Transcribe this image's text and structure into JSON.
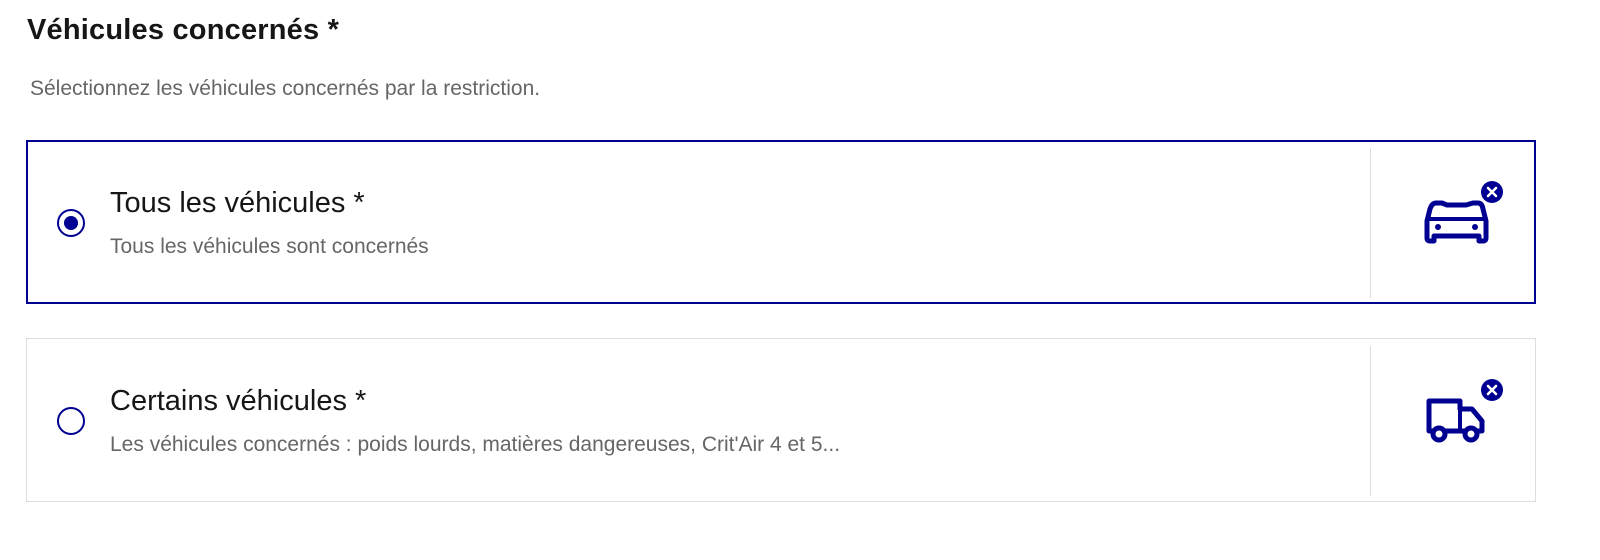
{
  "fieldset": {
    "legend": "Véhicules concernés *",
    "hint": "Sélectionnez les véhicules concernés par la restriction."
  },
  "options": [
    {
      "label": "Tous les véhicules *",
      "description": "Tous les véhicules sont concernés",
      "selected": true,
      "icon": "car-icon",
      "badge_icon": "close-badge-icon"
    },
    {
      "label": "Certains véhicules *",
      "description": "Les véhicules concernés : poids lourds, matières dangereuses, Crit'Air 4 et 5...",
      "selected": false,
      "icon": "truck-icon",
      "badge_icon": "close-badge-icon"
    }
  ],
  "colors": {
    "accent": "#000091",
    "text": "#161616",
    "muted": "#666666",
    "border": "#dddddd"
  }
}
